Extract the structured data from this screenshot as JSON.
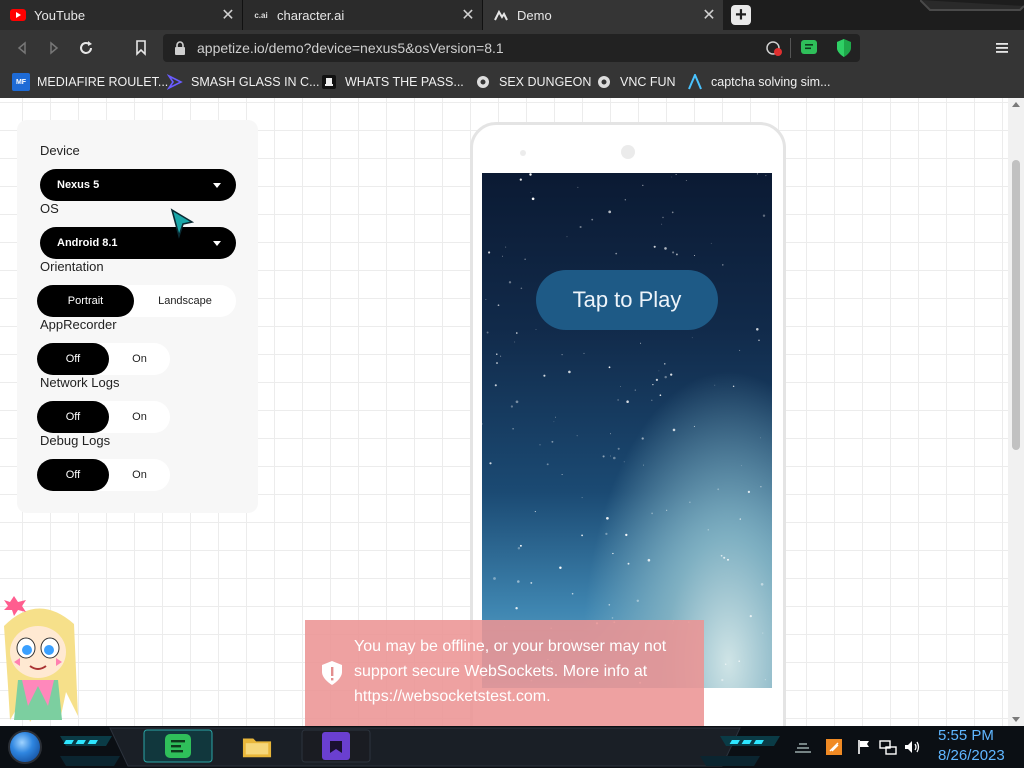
{
  "tabs": [
    {
      "title": "YouTube",
      "icon": "youtube-icon",
      "active": false
    },
    {
      "title": "character.ai",
      "icon": "character-ai-icon",
      "icon_text": "c.ai",
      "active": false
    },
    {
      "title": "Demo",
      "icon": "appetize-icon",
      "active": true
    }
  ],
  "toolbar": {
    "url": "appetize.io/demo?device=nexus5&osVersion=8.1"
  },
  "bookmarks": [
    {
      "label": "MEDIAFIRE ROULET...",
      "icon": "mediafire-icon",
      "icon_text": "MF"
    },
    {
      "label": "SMASH GLASS IN C...",
      "icon": "smash-glass-icon"
    },
    {
      "label": "WHATS THE PASS...",
      "icon": "bookmark-icon"
    },
    {
      "label": "SEX DUNGEON",
      "icon": "bookmark-icon"
    },
    {
      "label": "VNC FUN",
      "icon": "bookmark-icon"
    },
    {
      "label": "captcha solving sim...",
      "icon": "bookmark-icon"
    }
  ],
  "panel": {
    "device_label": "Device",
    "device_value": "Nexus 5",
    "os_label": "OS",
    "os_value": "Android 8.1",
    "orientation_label": "Orientation",
    "orientation_options": [
      "Portrait",
      "Landscape"
    ],
    "orientation_selected": "Portrait",
    "apprecorder_label": "AppRecorder",
    "network_label": "Network Logs",
    "debug_label": "Debug Logs",
    "toggle_off": "Off",
    "toggle_on": "On"
  },
  "device_screen": {
    "tap_label": "Tap to Play"
  },
  "toast": {
    "message": "You may be offline, or your browser may not support secure WebSockets. More info at https://websocketstest.com."
  },
  "taskbar": {
    "time": "5:55 PM",
    "date": "8/26/2023"
  },
  "colors": {
    "tabstrip": "#1d1d1d",
    "toolbar": "#353535",
    "toast": "#ec9494",
    "clock": "#5fb6ff",
    "tap_button": "#1e5a86"
  }
}
